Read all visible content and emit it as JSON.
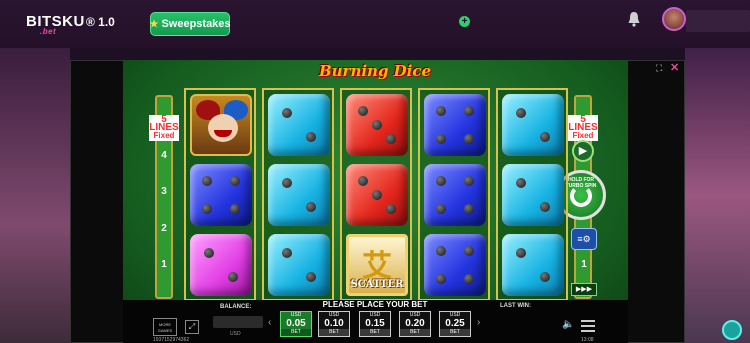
{
  "header": {
    "logo_text": "BITSKU",
    "logo_sub": ".bet",
    "version": "® 1.0",
    "sweepstakes_label": "Sweepstakes",
    "plus_label": "+"
  },
  "game": {
    "title": "Burning Dice",
    "left_lines_label": "5 LINES",
    "left_lines_sub": "Fixed",
    "right_lines_label": "5 LINES",
    "right_lines_sub": "Fixed",
    "line_numbers": [
      "4",
      "3",
      "2",
      "1"
    ],
    "right_line_number": "1",
    "turbo_text": "HOLD FOR TURBO SPIN",
    "reels": [
      [
        {
          "type": "joker"
        },
        {
          "type": "die",
          "color": "blue",
          "pips": 4
        },
        {
          "type": "die",
          "color": "pink",
          "pips": 2
        }
      ],
      [
        {
          "type": "die",
          "color": "cyan",
          "pips": 2
        },
        {
          "type": "die",
          "color": "cyan",
          "pips": 2
        },
        {
          "type": "die",
          "color": "cyan",
          "pips": 2
        }
      ],
      [
        {
          "type": "die",
          "color": "red",
          "pips": 3
        },
        {
          "type": "die",
          "color": "red",
          "pips": 3
        },
        {
          "type": "scatter"
        }
      ],
      [
        {
          "type": "die",
          "color": "blue",
          "pips": 4
        },
        {
          "type": "die",
          "color": "blue",
          "pips": 4
        },
        {
          "type": "die",
          "color": "blue",
          "pips": 4
        }
      ],
      [
        {
          "type": "die",
          "color": "cyan",
          "pips": 2
        },
        {
          "type": "die",
          "color": "cyan",
          "pips": 2
        },
        {
          "type": "die",
          "color": "cyan",
          "pips": 2
        }
      ]
    ],
    "scatter_glyph": "艾",
    "scatter_word": "SCATTER"
  },
  "bottom": {
    "balance_label": "BALANCE:",
    "balance_currency": "USD",
    "prompt": "PLEASE PLACE YOUR BET",
    "last_win_label": "LAST WIN:",
    "more_games": "MORE GAMES",
    "bets": [
      {
        "currency": "USD",
        "value": "0.05",
        "label": "BET",
        "selected": true
      },
      {
        "currency": "USD",
        "value": "0.10",
        "label": "BET",
        "selected": false
      },
      {
        "currency": "USD",
        "value": "0.15",
        "label": "BET",
        "selected": false
      },
      {
        "currency": "USD",
        "value": "0.20",
        "label": "BET",
        "selected": false
      },
      {
        "currency": "USD",
        "value": "0.25",
        "label": "BET",
        "selected": false
      }
    ],
    "footer_id": "1937152974362",
    "footer_time": "13:08"
  },
  "colors": {
    "accent_green": "#1c7a2b",
    "brand_pink": "#e34ba0"
  }
}
